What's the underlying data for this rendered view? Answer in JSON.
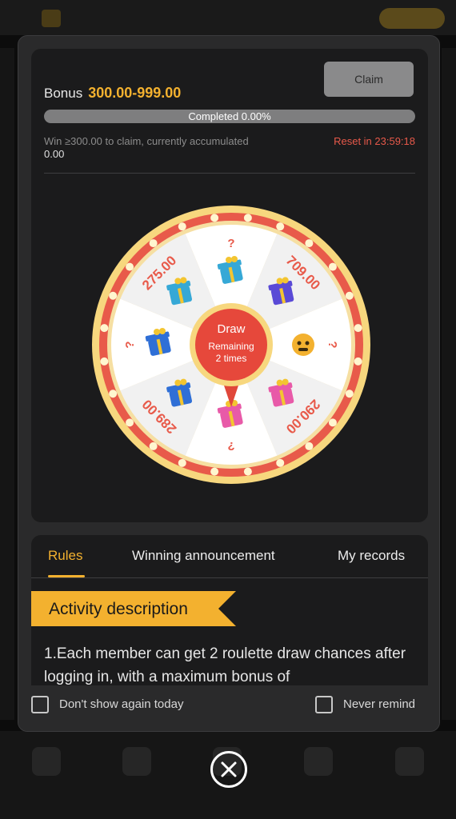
{
  "bonus": {
    "label": "Bonus",
    "range": "300.00-999.00"
  },
  "claim_button": "Claim",
  "progress": {
    "text": "Completed 0.00%",
    "fraction": 0.0
  },
  "win_info": {
    "text": "Win ≥300.00 to claim, currently accumulated ",
    "accumulated": "0.00"
  },
  "reset_text": "Reset in 23:59:18",
  "wheel": {
    "center_label": "Draw",
    "remaining_line1": "Remaining",
    "remaining_line2": "2 times",
    "segments": [
      {
        "label": "?",
        "icon": "gift-box-icon",
        "gift_color": "#36a8d6"
      },
      {
        "label": "709.00",
        "icon": "gift-box-icon",
        "gift_color": "#5a4ad6"
      },
      {
        "label": "?",
        "icon": "emoji-face-icon",
        "gift_color": "#f3b12f"
      },
      {
        "label": "290.00",
        "icon": "gift-box-icon",
        "gift_color": "#e85aa8"
      },
      {
        "label": "?",
        "icon": "gift-box-icon",
        "gift_color": "#e85aa8"
      },
      {
        "label": "289.00",
        "icon": "gift-box-icon",
        "gift_color": "#2f6fd6"
      },
      {
        "label": "?",
        "icon": "gift-box-icon",
        "gift_color": "#2f6fd6"
      },
      {
        "label": "275.00",
        "icon": "gift-box-icon",
        "gift_color": "#36a8d6"
      }
    ],
    "segment_colors": [
      "#ffffff",
      "#f1f1f1"
    ],
    "rim_color": "#e85a4a",
    "label_color": "#e85a4a"
  },
  "tabs": [
    "Rules",
    "Winning announcement",
    "My records"
  ],
  "activity_title": "Activity description",
  "description": "1.Each member can get 2 roulette draw chances after logging in, with a maximum bonus of",
  "footer": {
    "dont_show_label": "Don't show again today",
    "never_remind_label": "Never remind"
  },
  "colors": {
    "accent": "#f3b12f",
    "danger": "#e7594a"
  }
}
